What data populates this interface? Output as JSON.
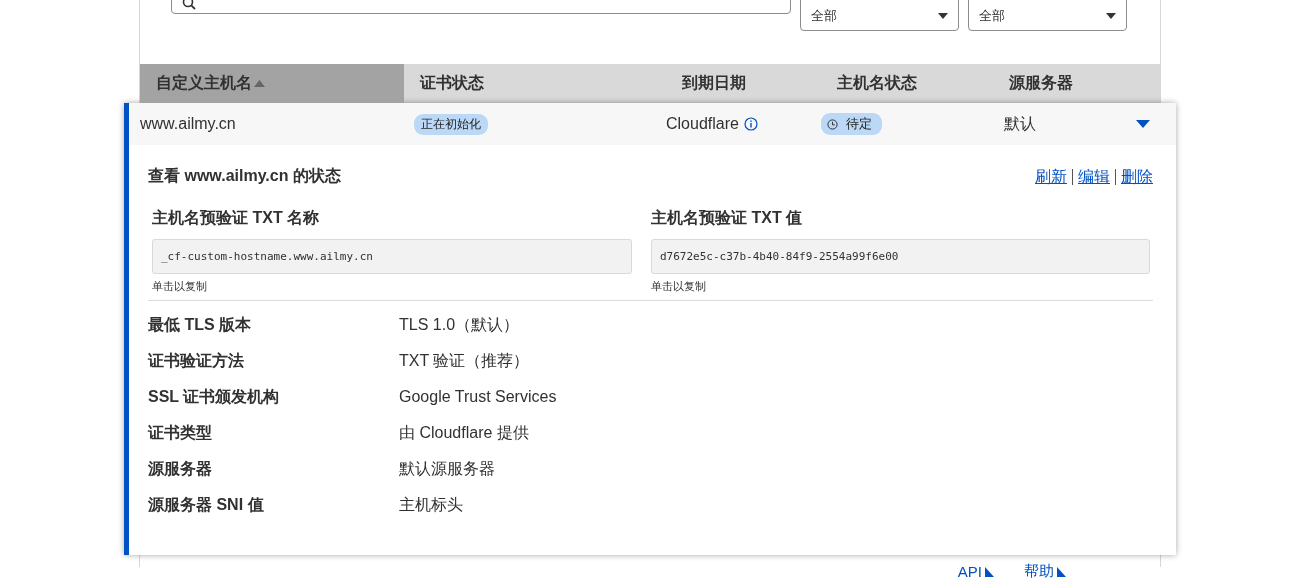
{
  "filters": {
    "dropdowns": [
      {
        "value": "全部"
      },
      {
        "value": "全部"
      }
    ]
  },
  "table": {
    "columns": [
      {
        "label": "自定义主机名",
        "sorted": true
      },
      {
        "label": "证书状态",
        "sorted": false
      },
      {
        "label": "到期日期",
        "sorted": false
      },
      {
        "label": "主机名状态",
        "sorted": false
      },
      {
        "label": "源服务器",
        "sorted": false
      }
    ],
    "rows": [
      {
        "hostname": "www.ailmy.cn",
        "cert_status": "正在初始化",
        "expiry": "Cloudflare",
        "hostname_status": "待定",
        "origin": "默认",
        "expanded": true,
        "details": {
          "title": "查看 www.ailmy.cn 的状态",
          "actions": [
            "刷新",
            "编辑",
            "删除"
          ],
          "txt_fields": [
            {
              "label": "主机名预验证 TXT 名称",
              "value": "_cf-custom-hostname.www.ailmy.cn",
              "hint": "单击以复制"
            },
            {
              "label": "主机名预验证 TXT 值",
              "value": "d7672e5c-c37b-4b40-84f9-2554a99f6e00",
              "hint": "单击以复制"
            }
          ],
          "properties": [
            {
              "label": "最低 TLS 版本",
              "value": "TLS 1.0（默认）"
            },
            {
              "label": "证书验证方法",
              "value": "TXT 验证（推荐）"
            },
            {
              "label": "SSL 证书颁发机构",
              "value": "Google Trust Services"
            },
            {
              "label": "证书类型",
              "value": "由 Cloudflare 提供"
            },
            {
              "label": "源服务器",
              "value": "默认源服务器"
            },
            {
              "label": "源服务器 SNI 值",
              "value": "主机标头"
            }
          ]
        }
      }
    ]
  },
  "footer_links": [
    "API",
    "帮助"
  ]
}
